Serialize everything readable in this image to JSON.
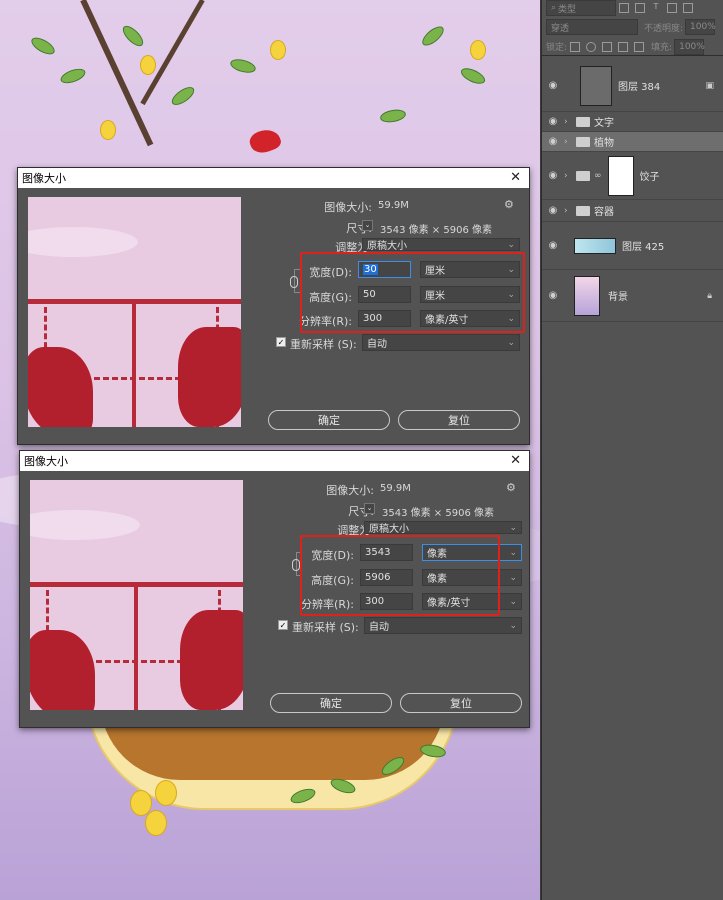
{
  "panel": {
    "search_placeholder": "类型",
    "blend_mode": "穿透",
    "opacity_label": "不透明度:",
    "opacity_value": "100%",
    "lock_label": "锁定:",
    "fill_label": "填充:",
    "fill_value": "100%",
    "layers": [
      {
        "name": "图层 384",
        "kind": "layer"
      },
      {
        "name": "文字",
        "kind": "group"
      },
      {
        "name": "植物",
        "kind": "group",
        "selected": true
      },
      {
        "name": "饺子",
        "kind": "group-mask"
      },
      {
        "name": "容器",
        "kind": "group"
      },
      {
        "name": "图层 425",
        "kind": "layer"
      },
      {
        "name": "背景",
        "kind": "background",
        "locked": true
      }
    ]
  },
  "dialogs": [
    {
      "title": "图像大小",
      "image_size_label": "图像大小:",
      "image_size_value": "59.9M",
      "dimensions_label": "尺寸:",
      "dimensions_value": "3543 像素 × 5906 像素",
      "fit_label": "调整为:",
      "fit_value": "原稿大小",
      "width_label": "宽度(D):",
      "width_value": "30",
      "width_unit": "厘米",
      "height_label": "高度(G):",
      "height_value": "50",
      "height_unit": "厘米",
      "resolution_label": "分辨率(R):",
      "resolution_value": "300",
      "resolution_unit": "像素/英寸",
      "resample_label": "重新采样 (S):",
      "resample_value": "自动",
      "ok_label": "确定",
      "reset_label": "复位"
    },
    {
      "title": "图像大小",
      "image_size_label": "图像大小:",
      "image_size_value": "59.9M",
      "dimensions_label": "尺寸:",
      "dimensions_value": "3543 像素 × 5906 像素",
      "fit_label": "调整为:",
      "fit_value": "原稿大小",
      "width_label": "宽度(D):",
      "width_value": "3543",
      "width_unit": "像素",
      "height_label": "高度(G):",
      "height_value": "5906",
      "height_unit": "像素",
      "resolution_label": "分辨率(R):",
      "resolution_value": "300",
      "resolution_unit": "像素/英寸",
      "resample_label": "重新采样 (S):",
      "resample_value": "自动",
      "ok_label": "确定",
      "reset_label": "复位"
    }
  ],
  "colors": {
    "highlight_box": "#e0211b",
    "panel_bg": "#535353",
    "selection_blue": "#1f6fd6"
  }
}
